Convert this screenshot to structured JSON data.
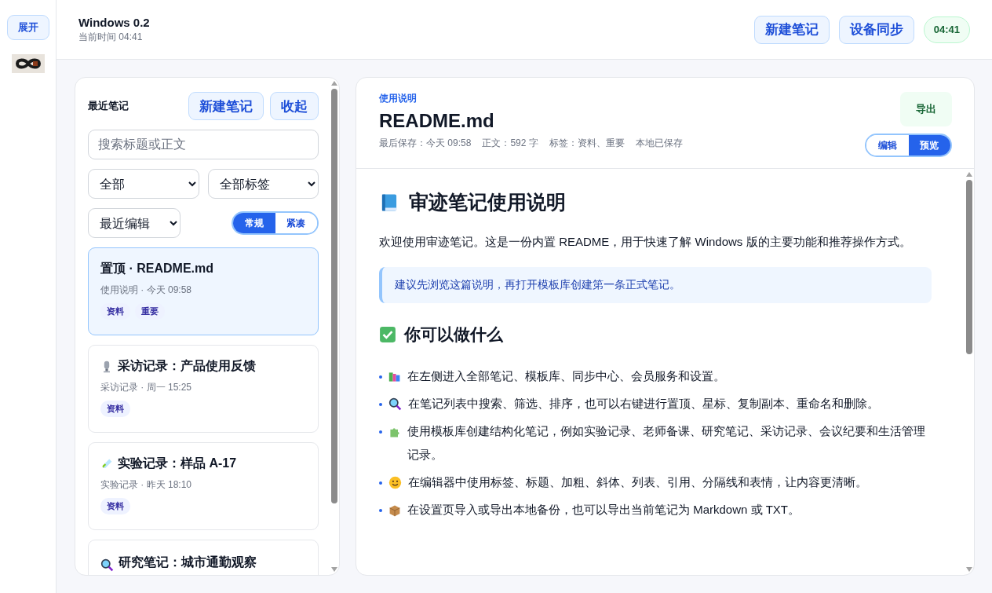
{
  "rail": {
    "expand_button": "展开"
  },
  "header": {
    "title": "Windows 0.2",
    "subtitle": "当前时间 04:41",
    "buttons": [
      "新建笔记",
      "设备同步"
    ],
    "clock": "04:41"
  },
  "notes_panel": {
    "title": "最近笔记",
    "buttons": [
      "新建笔记",
      "收起"
    ],
    "search": {
      "placeholder": "搜索标题或正文"
    },
    "filters": [
      {
        "value": "全部"
      },
      {
        "value": "全部标签"
      }
    ],
    "sort": {
      "value": "最近编辑"
    },
    "density": [
      {
        "label": "常规",
        "selected": true
      },
      {
        "label": "紧凑",
        "selected": false
      }
    ],
    "notes": [
      {
        "title": "置顶 · README.md",
        "meta": "使用说明 · 今天 09:58",
        "tags": [
          "资料",
          "重要"
        ],
        "selected": true
      },
      {
        "title": "采访记录：产品使用反馈",
        "meta": "采访记录 · 周一 15:25",
        "tags": [
          "资料"
        ],
        "selected": false
      },
      {
        "title": "实验记录：样品 A-17",
        "meta": "实验记录 · 昨天 18:10",
        "tags": [
          "资料"
        ],
        "selected": false
      },
      {
        "title": "研究笔记：城市通勤观察",
        "selected": false
      }
    ]
  },
  "document": {
    "category": "使用说明",
    "title": "README.md",
    "meta": [
      "最后保存：今天 09:58",
      "正文：592 字",
      "标签：资料、重要",
      "本地已保存"
    ],
    "export_button": "导出",
    "modes": [
      {
        "label": "编辑",
        "selected": false
      },
      {
        "label": "预览",
        "selected": true
      }
    ],
    "body": [
      {
        "kind": "h1",
        "text": "审迹笔记使用说明"
      },
      {
        "kind": "p",
        "text": "欢迎使用审迹笔记。这是一份内置 README，用于快速了解 Windows 版的主要功能和推荐操作方式。"
      },
      {
        "kind": "quote",
        "text": "建议先浏览这篇说明，再打开模板库创建第一条正式笔记。"
      },
      {
        "kind": "h2",
        "text": "你可以做什么"
      },
      {
        "kind": "li",
        "text": "在左侧进入全部笔记、模板库、同步中心、会员服务和设置。"
      },
      {
        "kind": "li",
        "text": "在笔记列表中搜索、筛选、排序，也可以右键进行置顶、星标、复制副本、重命名和删除。"
      },
      {
        "kind": "li",
        "text": "使用模板库创建结构化笔记，例如实验记录、老师备课、研究笔记、采访记录、会议纪要和生活管理记录。"
      },
      {
        "kind": "li",
        "text": "在编辑器中使用标签、标题、加粗、斜体、列表、引用、分隔线和表情，让内容更清晰。"
      },
      {
        "kind": "li",
        "text": "在设置页导入或导出本地备份，也可以导出当前笔记为 Markdown 或 TXT。"
      }
    ]
  }
}
